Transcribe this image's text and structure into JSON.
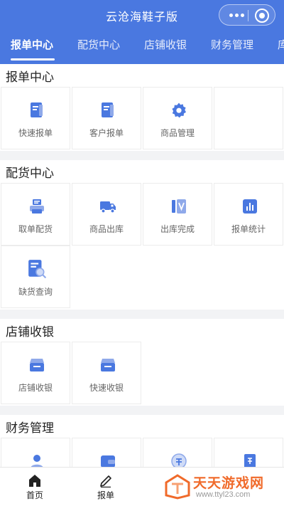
{
  "app": {
    "title": "云沧海鞋子版"
  },
  "tabs": [
    {
      "label": "报单中心"
    },
    {
      "label": "配货中心"
    },
    {
      "label": "店铺收银"
    },
    {
      "label": "财务管理"
    },
    {
      "label": "库"
    }
  ],
  "sections": {
    "orders": {
      "title": "报单中心",
      "items": [
        {
          "label": "快速报单",
          "icon": "document-icon"
        },
        {
          "label": "客户报单",
          "icon": "document-icon"
        },
        {
          "label": "商品管理",
          "icon": "gear-icon"
        }
      ]
    },
    "distribution": {
      "title": "配货中心",
      "items": [
        {
          "label": "取单配货",
          "icon": "printer-icon"
        },
        {
          "label": "商品出库",
          "icon": "truck-icon"
        },
        {
          "label": "出库完成",
          "icon": "checkout-icon"
        },
        {
          "label": "报单统计",
          "icon": "bar-chart-icon"
        },
        {
          "label": "缺货查询",
          "icon": "search-document-icon"
        }
      ]
    },
    "cashier": {
      "title": "店铺收银",
      "items": [
        {
          "label": "店铺收银",
          "icon": "cash-box-icon"
        },
        {
          "label": "快速收银",
          "icon": "cash-box-icon"
        }
      ]
    },
    "finance": {
      "title": "财务管理",
      "items": [
        {
          "icon": "person-icon"
        },
        {
          "icon": "wallet-icon"
        },
        {
          "icon": "coin-icon"
        },
        {
          "icon": "receipt-icon"
        }
      ]
    }
  },
  "bottom_nav": [
    {
      "label": "首页",
      "icon": "home-icon"
    },
    {
      "label": "报单",
      "icon": "edit-icon"
    }
  ],
  "watermark": {
    "text": "天天游戏网",
    "url": "www.ttyl23.com"
  },
  "colors": {
    "brand": "#4a78e0",
    "icon": "#4a78e0",
    "watermark": "#f06a2a"
  }
}
